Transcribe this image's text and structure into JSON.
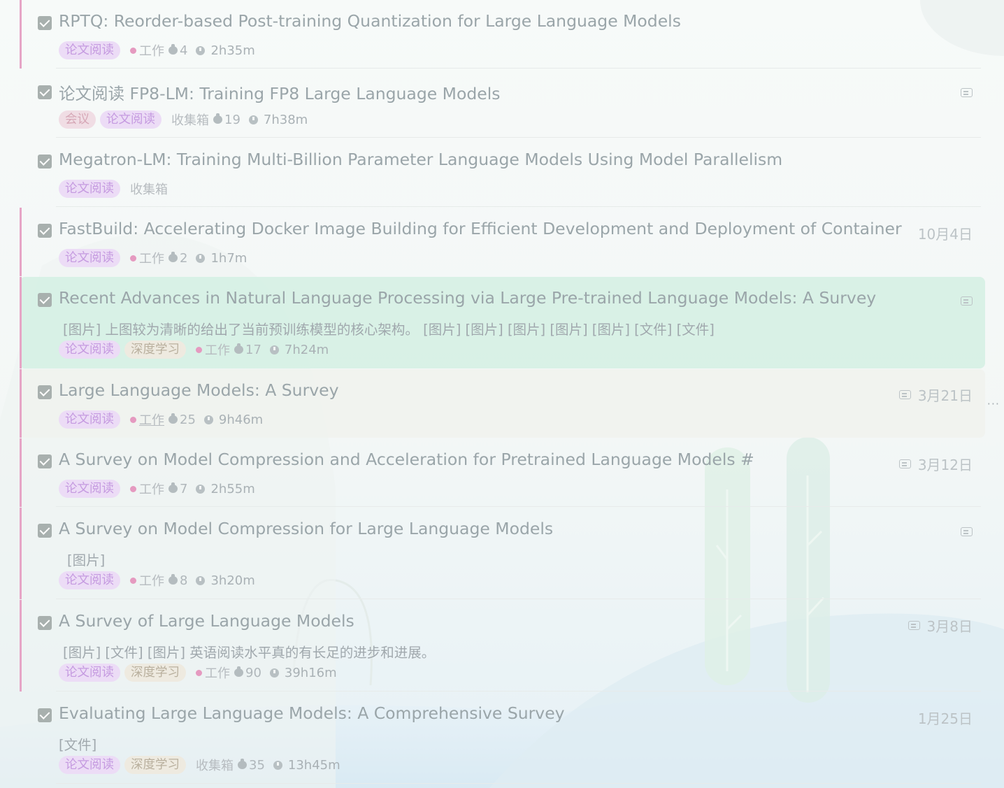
{
  "tasks": [
    {
      "title": "RPTQ: Reorder-based Post-training Quantization for Large Language Models",
      "tags": [
        "论文阅读"
      ],
      "list": "工作",
      "pomodoros": "4",
      "duration": "2h35m",
      "date": "",
      "has_comment": false
    },
    {
      "title": "论文阅读 FP8-LM: Training FP8 Large Language Models",
      "tags": [
        "会议",
        "论文阅读"
      ],
      "list": "收集箱",
      "pomodoros": "19",
      "duration": "7h38m",
      "date": "",
      "has_comment": true
    },
    {
      "title": "Megatron-LM: Training Multi-Billion Parameter Language Models Using Model Parallelism",
      "tags": [
        "论文阅读"
      ],
      "list": "收集箱",
      "pomodoros": "",
      "duration": "",
      "date": "",
      "has_comment": false
    },
    {
      "title": "FastBuild: Accelerating Docker Image Building for Efficient Development and Deployment of Container",
      "tags": [
        "论文阅读"
      ],
      "list": "工作",
      "pomodoros": "2",
      "duration": "1h7m",
      "date": "10月4日",
      "has_comment": false
    },
    {
      "title": "Recent Advances in Natural Language Processing via Large Pre-trained Language Models: A Survey",
      "note": "[图片]  上图较为清晰的给出了当前预训练模型的核心架构。   [图片] [图片]    [图片]   [图片] [图片]  [文件]   [文件]",
      "tags": [
        "论文阅读",
        "深度学习"
      ],
      "list": "工作",
      "pomodoros": "17",
      "duration": "7h24m",
      "date": "",
      "has_comment": true,
      "selected": true
    },
    {
      "title": "Large Language Models: A Survey",
      "tags": [
        "论文阅读"
      ],
      "list": "工作",
      "pomodoros": "25",
      "duration": "9h46m",
      "date": "3月21日",
      "has_comment": true,
      "hovered": true
    },
    {
      "title": "A Survey on Model Compression and Acceleration for Pretrained Language Models #",
      "tags": [
        "论文阅读"
      ],
      "list": "工作",
      "pomodoros": "7",
      "duration": "2h55m",
      "date": "3月12日",
      "has_comment": true
    },
    {
      "title": "A Survey on Model Compression for Large Language Models",
      "note": "[图片]",
      "tags": [
        "论文阅读"
      ],
      "list": "工作",
      "pomodoros": "8",
      "duration": "3h20m",
      "date": "",
      "has_comment": true
    },
    {
      "title": "A Survey of Large Language Models",
      "note": "[图片] [文件]   [图片]   英语阅读水平真的有长足的进步和进展。",
      "tags": [
        "论文阅读",
        "深度学习"
      ],
      "list": "工作",
      "pomodoros": "90",
      "duration": "39h16m",
      "date": "3月8日",
      "has_comment": true
    },
    {
      "title": "Evaluating Large Language Models: A Comprehensive Survey",
      "note": "[文件]",
      "tags": [
        "论文阅读",
        "深度学习"
      ],
      "list": "收集箱",
      "pomodoros": "35",
      "duration": "13h45m",
      "date": "1月25日",
      "has_comment": false
    }
  ],
  "more_menu": "···",
  "colors": {
    "list_dot": "#e59ac0",
    "priority_bar": "#e6a5c6",
    "selected_bg": "#d6f0e4"
  }
}
